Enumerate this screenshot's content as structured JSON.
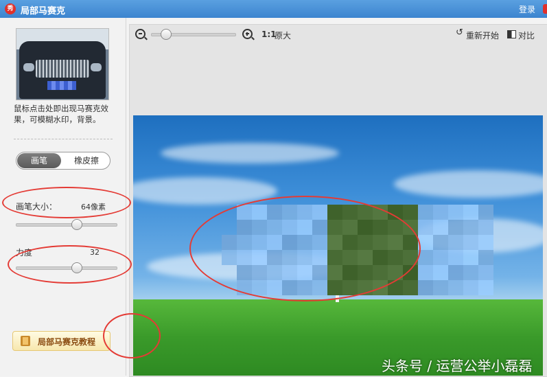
{
  "window": {
    "title": "局部马赛克",
    "login_label": "登录"
  },
  "sidebar": {
    "description": "鼠标点击处即出现马赛克效果，可模糊水印，背景。",
    "tools": {
      "brush_label": "画笔",
      "eraser_label": "橡皮擦",
      "active": "brush"
    },
    "brush_size": {
      "label": "画笔大小：",
      "value": "64像素",
      "level": 0.6
    },
    "strength": {
      "label": "力度",
      "value": "32",
      "level": 0.6
    },
    "tutorial_label": "局部马赛克教程"
  },
  "toolbar": {
    "zoom_level": 0.12,
    "ratio_label": "1:1",
    "original_label": "原大",
    "restart_label": "重新开始",
    "compare_label": "对比"
  },
  "watermark": "头条号 / 运营公举小磊磊",
  "colors": {
    "titlebar": "#4a90d9",
    "annotation": "#e43b35",
    "tutorial_text": "#8a4b10"
  },
  "icons": [
    "app-logo-icon",
    "zoom-out-icon",
    "zoom-in-icon",
    "restart-icon",
    "compare-icon",
    "book-icon"
  ]
}
